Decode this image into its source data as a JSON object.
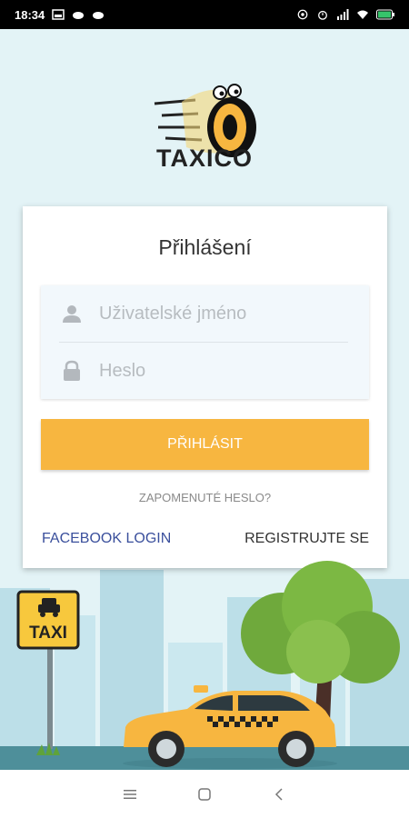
{
  "status_bar": {
    "time": "18:34"
  },
  "app": {
    "logo_text": "TAXICO"
  },
  "login": {
    "title": "Přihlášení",
    "username_placeholder": "Uživatelské jméno",
    "password_placeholder": "Heslo",
    "login_button": "PŘIHLÁSIT",
    "forgot_password": "ZAPOMENUTÉ HESLO?",
    "facebook_login": "FACEBOOK LOGIN",
    "register": "REGISTRUJTE SE"
  },
  "illustration": {
    "taxi_sign_text": "TAXI"
  },
  "colors": {
    "accent": "#f7b640",
    "background": "#e3f3f6",
    "facebook": "#3a4f9c"
  },
  "icons": [
    "user-icon",
    "lock-icon",
    "menu-icon",
    "home-icon",
    "back-icon"
  ]
}
